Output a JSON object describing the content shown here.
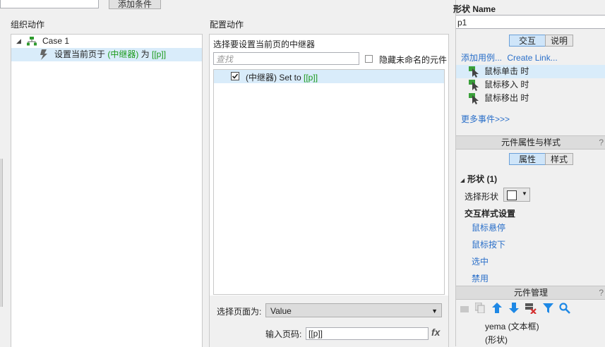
{
  "dialog": {
    "add_condition_label": "添加条件",
    "organize_title": "组织动作",
    "configure_title": "配置动作",
    "tree": {
      "case_label": "Case 1",
      "action_prefix": "设置当前页于 ",
      "action_target": "(中继器)",
      "action_mid": " 为 ",
      "action_value": "[[p]]"
    },
    "config": {
      "select_label": "选择要设置当前页的中继器",
      "search_placeholder": "查找",
      "hide_unnamed_label": "隐藏未命名的元件",
      "repeater_item_name": "(中继器) Set to ",
      "repeater_item_value": "[[p]]",
      "page_select_label": "选择页面为:",
      "page_select_value": "Value",
      "page_input_label": "输入页码:",
      "page_input_value": "[[p]]",
      "fx_label": "fx"
    }
  },
  "right_panel": {
    "shape_name_label": "形状 Name",
    "shape_name_value": "p1",
    "tabs1": [
      "交互",
      "说明"
    ],
    "add_case_link": "添加用例...",
    "create_link": "Create Link...",
    "events": [
      "鼠标单击 时",
      "鼠标移入 时",
      "鼠标移出 时"
    ],
    "more_events": "更多事件>>>",
    "props_header": "元件属性与样式",
    "help": "?",
    "tabs2": [
      "属性",
      "样式"
    ],
    "shape_section": "形状 (1)",
    "choose_shape_label": "选择形状",
    "interaction_style_title": "交互样式设置",
    "style_links": [
      "鼠标悬停",
      "鼠标按下",
      "选中",
      "禁用"
    ],
    "widget_manager_header": "元件管理",
    "widget_items": [
      "yema (文本框)",
      "(形状)"
    ],
    "colors": {
      "accent": "#1e88e5",
      "green": "#1a9a1a",
      "link": "#2a6fc9"
    }
  }
}
